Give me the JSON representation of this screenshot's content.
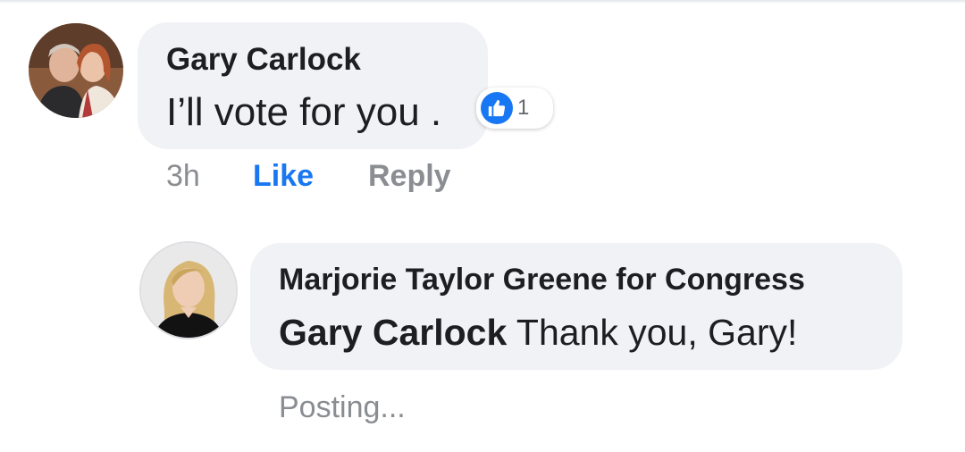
{
  "comment": {
    "author": "Gary Carlock",
    "text": "I’ll vote for you .",
    "reaction": {
      "icon": "thumbs-up-icon",
      "count": "1",
      "color": "#1877f2"
    },
    "actions": {
      "time": "3h",
      "like": "Like",
      "reply": "Reply"
    }
  },
  "reply": {
    "author": "Marjorie Taylor Greene for Congress",
    "mention": "Gary Carlock",
    "text": "Thank you, Gary!",
    "status": "Posting..."
  },
  "colors": {
    "bubble": "#f0f2f5",
    "accent": "#1877f2",
    "meta": "#8a8d91"
  }
}
